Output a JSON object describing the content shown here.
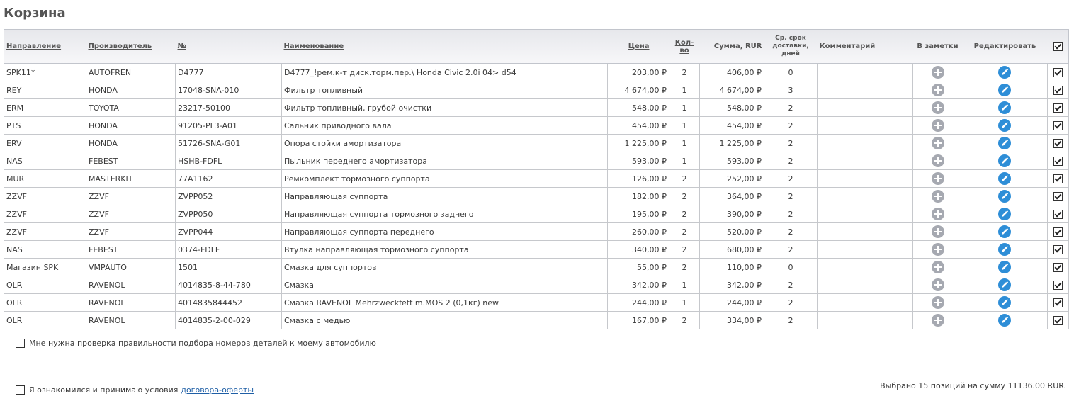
{
  "page_title": "Корзина",
  "columns": {
    "direction": "Направление",
    "manufacturer": "Производитель",
    "number": "№",
    "name": "Наименование",
    "price": "Цена",
    "qty": "Кол-во",
    "sum": "Сумма, RUR",
    "delivery_line1": "Ср. срок",
    "delivery_line2": "доставки,",
    "delivery_line3": "дней",
    "comment": "Комментарий",
    "notes": "В заметки",
    "edit": "Редактировать"
  },
  "header_checkbox_checked": true,
  "rows": [
    {
      "direction": "SPK11*",
      "manufacturer": "AUTOFREN",
      "number": "D4777",
      "name": "D4777_!рем.к-т диск.торм.пер.\\ Honda Civic 2.0i 04> d54",
      "price": "203,00 ₽",
      "qty": "2",
      "sum": "406,00 ₽",
      "delivery": "0",
      "comment": "",
      "checked": true
    },
    {
      "direction": "REY",
      "manufacturer": "HONDA",
      "number": "17048-SNA-010",
      "name": "Фильтр топливный",
      "price": "4 674,00 ₽",
      "qty": "1",
      "sum": "4 674,00 ₽",
      "delivery": "3",
      "comment": "",
      "checked": true
    },
    {
      "direction": "ERM",
      "manufacturer": "TOYOTA",
      "number": "23217-50100",
      "name": "Фильтр топливный, грубой очистки",
      "price": "548,00 ₽",
      "qty": "1",
      "sum": "548,00 ₽",
      "delivery": "2",
      "comment": "",
      "checked": true
    },
    {
      "direction": "PTS",
      "manufacturer": "HONDA",
      "number": "91205-PL3-A01",
      "name": "Сальник приводного вала",
      "price": "454,00 ₽",
      "qty": "1",
      "sum": "454,00 ₽",
      "delivery": "2",
      "comment": "",
      "checked": true
    },
    {
      "direction": "ERV",
      "manufacturer": "HONDA",
      "number": "51726-SNA-G01",
      "name": "Опора стойки амортизатора",
      "price": "1 225,00 ₽",
      "qty": "1",
      "sum": "1 225,00 ₽",
      "delivery": "2",
      "comment": "",
      "checked": true
    },
    {
      "direction": "NAS",
      "manufacturer": "FEBEST",
      "number": "HSHB-FDFL",
      "name": "Пыльник переднего амортизатора",
      "price": "593,00 ₽",
      "qty": "1",
      "sum": "593,00 ₽",
      "delivery": "2",
      "comment": "",
      "checked": true
    },
    {
      "direction": "MUR",
      "manufacturer": "MASTERKIT",
      "number": "77A1162",
      "name": "Ремкомплект тормозного суппорта",
      "price": "126,00 ₽",
      "qty": "2",
      "sum": "252,00 ₽",
      "delivery": "2",
      "comment": "",
      "checked": true
    },
    {
      "direction": "ZZVF",
      "manufacturer": "ZZVF",
      "number": "ZVPP052",
      "name": "Направляющая суппорта",
      "price": "182,00 ₽",
      "qty": "2",
      "sum": "364,00 ₽",
      "delivery": "2",
      "comment": "",
      "checked": true
    },
    {
      "direction": "ZZVF",
      "manufacturer": "ZZVF",
      "number": "ZVPP050",
      "name": "Направляющая суппорта тормозного заднего",
      "price": "195,00 ₽",
      "qty": "2",
      "sum": "390,00 ₽",
      "delivery": "2",
      "comment": "",
      "checked": true
    },
    {
      "direction": "ZZVF",
      "manufacturer": "ZZVF",
      "number": "ZVPP044",
      "name": "Направляющая суппорта переднего",
      "price": "260,00 ₽",
      "qty": "2",
      "sum": "520,00 ₽",
      "delivery": "2",
      "comment": "",
      "checked": true
    },
    {
      "direction": "NAS",
      "manufacturer": "FEBEST",
      "number": "0374-FDLF",
      "name": "Втулка направляющая тормозного суппорта",
      "price": "340,00 ₽",
      "qty": "2",
      "sum": "680,00 ₽",
      "delivery": "2",
      "comment": "",
      "checked": true
    },
    {
      "direction": "Магазин SPK",
      "manufacturer": "VMPAUTO",
      "number": "1501",
      "name": "Смазка для суппортов",
      "price": "55,00 ₽",
      "qty": "2",
      "sum": "110,00 ₽",
      "delivery": "0",
      "comment": "",
      "checked": true
    },
    {
      "direction": "OLR",
      "manufacturer": "RAVENOL",
      "number": "4014835-8-44-780",
      "name": "Смазка",
      "price": "342,00 ₽",
      "qty": "1",
      "sum": "342,00 ₽",
      "delivery": "2",
      "comment": "",
      "checked": true
    },
    {
      "direction": "OLR",
      "manufacturer": "RAVENOL",
      "number": "4014835844452",
      "name": "Смазка RAVENOL Mehrzweckfett m.MOS 2 (0,1кг) new",
      "price": "244,00 ₽",
      "qty": "1",
      "sum": "244,00 ₽",
      "delivery": "2",
      "comment": "",
      "checked": true
    },
    {
      "direction": "OLR",
      "manufacturer": "RAVENOL",
      "number": "4014835-2-00-029",
      "name": "Смазка с медью",
      "price": "167,00 ₽",
      "qty": "2",
      "sum": "334,00 ₽",
      "delivery": "2",
      "comment": "",
      "checked": true
    }
  ],
  "check_option": {
    "label": "Мне нужна проверка правильности подбора номеров деталей к моему автомобилю",
    "checked": false
  },
  "agree_option": {
    "label": "Я ознакомился и принимаю условия",
    "link": "договора-оферты",
    "checked": false
  },
  "summary": "Выбрано 15 позиций на сумму 11136.00 RUR.",
  "colors": {
    "add_icon": "#a6a9b1",
    "edit_icon": "#2e8ed7",
    "link": "#1f5fa6"
  },
  "icons": {
    "add": "plus-circle-icon",
    "edit": "pencil-circle-icon"
  }
}
